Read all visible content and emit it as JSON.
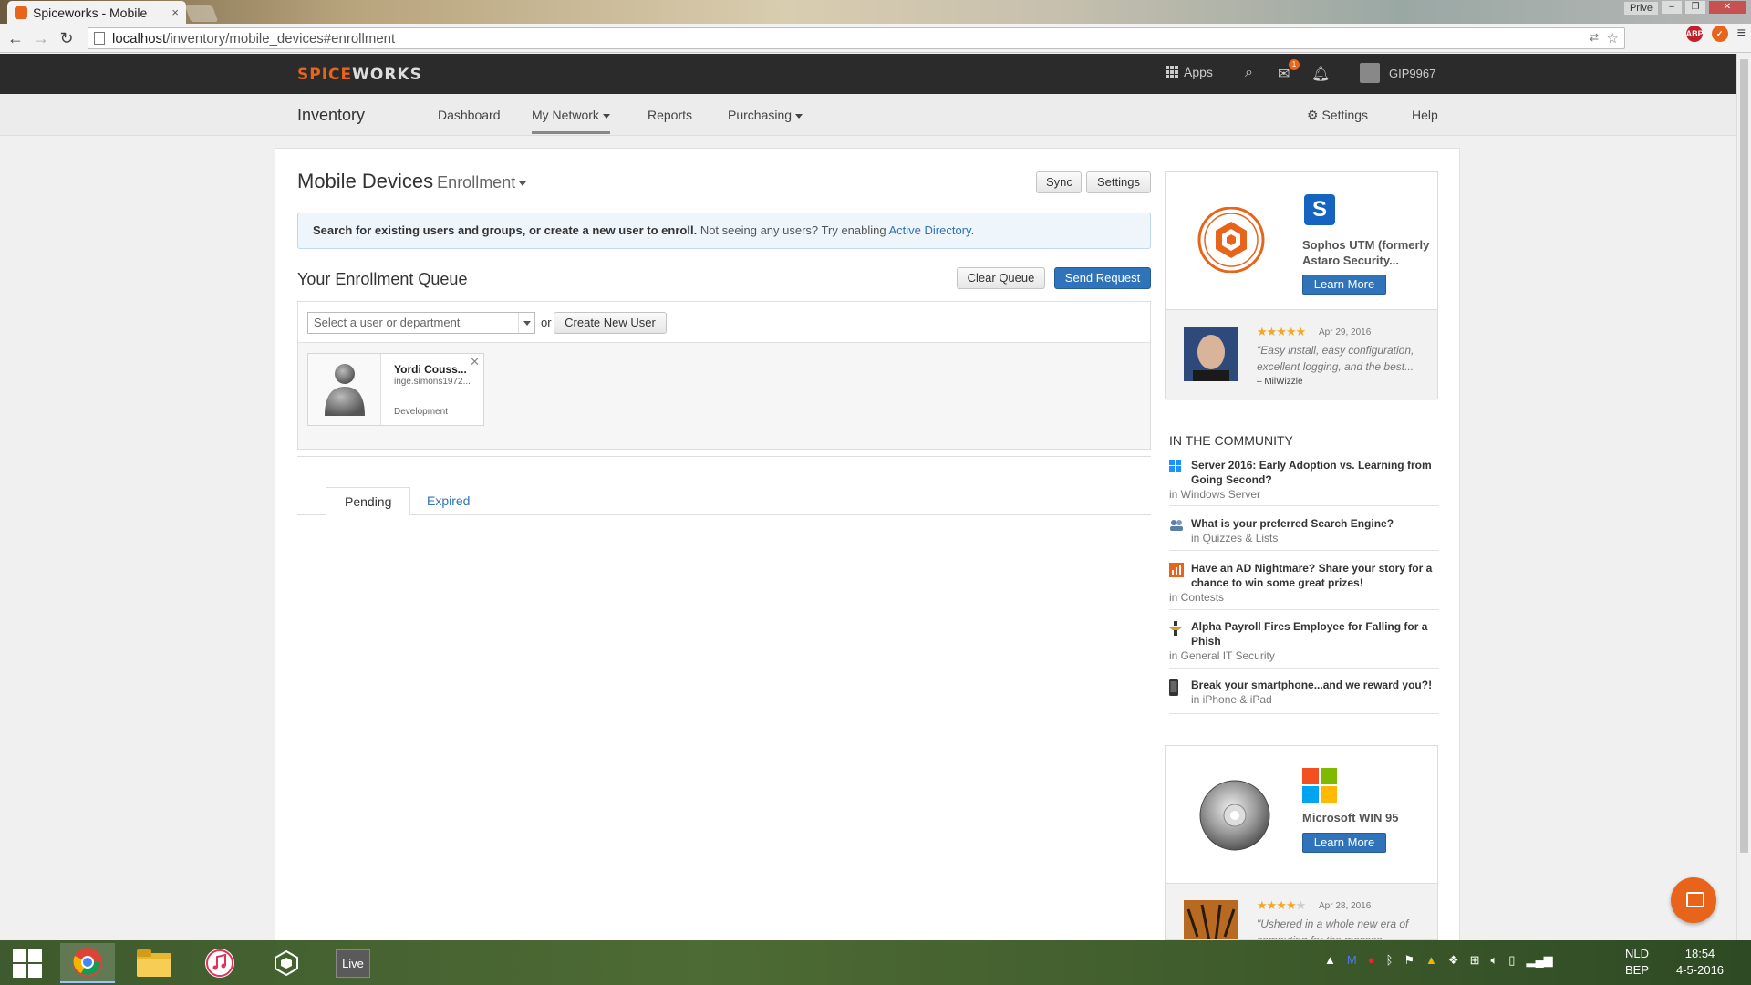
{
  "browser": {
    "tab_title": "Spiceworks - Mobile",
    "tab_close": "×",
    "profile": "Prive",
    "url_host": "localhost",
    "url_path": "/inventory/mobile_devices#enrollment",
    "abp_badge": "ABP"
  },
  "topbar": {
    "logo_spice": "SPICE",
    "logo_works": "WORKS",
    "apps_label": "Apps",
    "inbox_badge": "1",
    "username": "GIP9967",
    "accent_color": "#e8641b"
  },
  "subnav": {
    "title": "Inventory",
    "items": [
      "Dashboard",
      "My Network",
      "Reports",
      "Purchasing"
    ],
    "settings": "Settings",
    "help": "Help"
  },
  "page": {
    "title": "Mobile Devices",
    "subtitle": "Enrollment",
    "sync_button": "Sync",
    "settings_button": "Settings",
    "info_bold": "Search for existing users and groups, or create a new user to enroll.",
    "info_text": "Not seeing any users? Try enabling",
    "info_link": "Active Directory",
    "info_end": ".",
    "queue_title": "Your Enrollment Queue",
    "clear_queue": "Clear Queue",
    "send_request": "Send Request",
    "select_placeholder": "Select a user or department",
    "or_text": "or",
    "create_user": "Create New User",
    "queued_user": {
      "name": "Yordi Couss...",
      "email": "inge.simons1972...",
      "department": "Development"
    },
    "tabs": [
      "Pending",
      "Expired"
    ]
  },
  "sidebar": {
    "ad1": {
      "product": "Sophos UTM (formerly Astaro Security...",
      "learn_more": "Learn More",
      "stars": "★★★★★",
      "date": "Apr 29, 2016",
      "quote": "\"Easy install, easy configuration, excellent logging, and the best...",
      "author": "– MilWizzle"
    },
    "community_title": "IN THE COMMUNITY",
    "community": [
      {
        "title": "Server 2016: Early Adoption vs. Learning from Going Second?",
        "category": "in Windows Server",
        "icon": "windows-icon"
      },
      {
        "title": "What is your preferred Search Engine?",
        "category": "in Quizzes & Lists",
        "icon": "users-icon"
      },
      {
        "title": "Have an AD Nightmare? Share your story for a chance to win some great prizes!",
        "category": "in Contests",
        "icon": "chart-icon"
      },
      {
        "title": "Alpha Payroll Fires Employee for Falling for a Phish",
        "category": "in General IT Security",
        "icon": "security-icon"
      },
      {
        "title": "Break your smartphone...and we reward you?!",
        "category": "in iPhone & iPad",
        "icon": "phone-icon"
      }
    ],
    "ad2": {
      "product": "Microsoft WIN 95",
      "learn_more": "Learn More",
      "stars": "★★★★",
      "star_empty": "★",
      "date": "Apr 28, 2016",
      "quote": "\"Ushered in a whole new era of computing for the masses..."
    }
  },
  "taskbar": {
    "live_label": "Live",
    "lang_top": "NLD",
    "lang_bottom": "BEP",
    "time": "18:54",
    "date": "4-5-2016"
  }
}
